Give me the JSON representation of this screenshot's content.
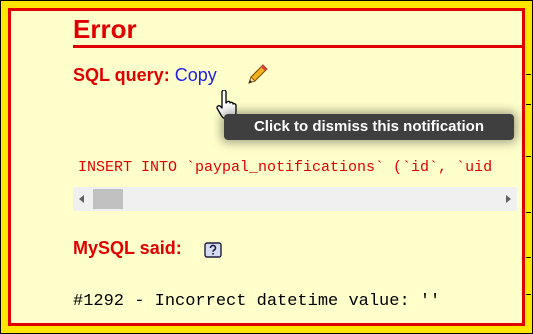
{
  "error_panel": {
    "title": "Error",
    "sql_query_label": "SQL query:",
    "copy_link": "Copy",
    "sql_code": "INSERT INTO `paypal_notifications` (`id`, `uid",
    "mysql_said_label": "MySQL said:",
    "error_message": "#1292 - Incorrect datetime value: ''"
  },
  "tooltip": {
    "text": "Click to dismiss this notification"
  },
  "icons": {
    "edit": "pencil-icon",
    "help": "help-icon",
    "cursor": "hand-pointer-icon"
  },
  "colors": {
    "background": "#FFFFCC",
    "frame_yellow": "#FFE600",
    "error_red": "#E00000",
    "link_blue": "#1E1EE6",
    "tooltip_bg": "#3F3F3F"
  }
}
